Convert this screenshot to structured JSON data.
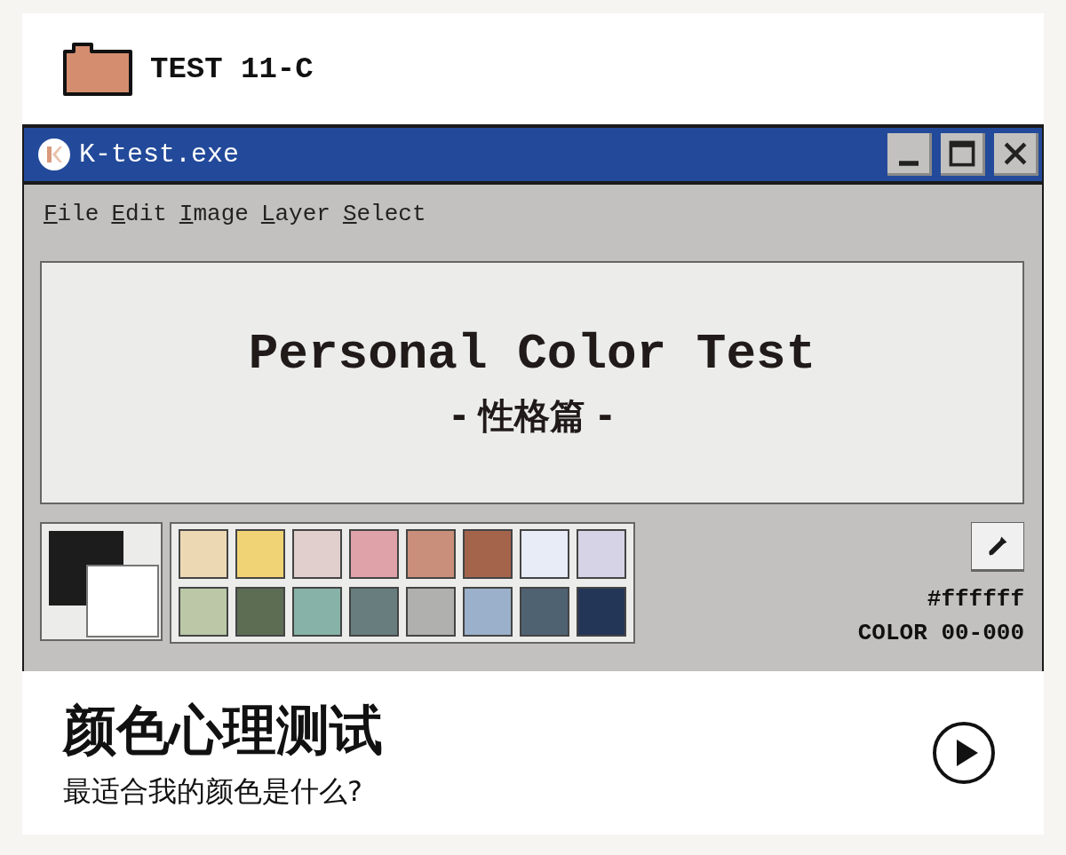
{
  "header": {
    "title": "TEST 11-C"
  },
  "window": {
    "title": "K-test.exe",
    "controls": [
      {
        "kind": "minimize"
      },
      {
        "kind": "maximize"
      },
      {
        "kind": "close"
      }
    ]
  },
  "menu": [
    "File",
    "Edit",
    "Image",
    "Layer",
    "Select"
  ],
  "canvas": {
    "title": "Personal Color Test",
    "subtitle": "- 性格篇 -"
  },
  "palette": [
    {
      "color": "#ecd9b4"
    },
    {
      "color": "#f0d374"
    },
    {
      "color": "#e0cfcc"
    },
    {
      "color": "#dfa2a8"
    },
    {
      "color": "#c98f7a"
    },
    {
      "color": "#a4644c"
    },
    {
      "color": "#e8ecf7"
    },
    {
      "color": "#d6d3e6"
    },
    {
      "color": "#bbc7a7"
    },
    {
      "color": "#5c6d54"
    },
    {
      "color": "#87b2a7"
    },
    {
      "color": "#687e7e"
    },
    {
      "color": "#b0b1af"
    },
    {
      "color": "#9bb0ca"
    },
    {
      "color": "#4f6272"
    },
    {
      "color": "#243658"
    }
  ],
  "color_info": {
    "hex": "#ffffff",
    "code": "COLOR 00-000"
  },
  "footer": {
    "title": "颜色心理测试",
    "subtitle": "最适合我的颜色是什么?"
  }
}
